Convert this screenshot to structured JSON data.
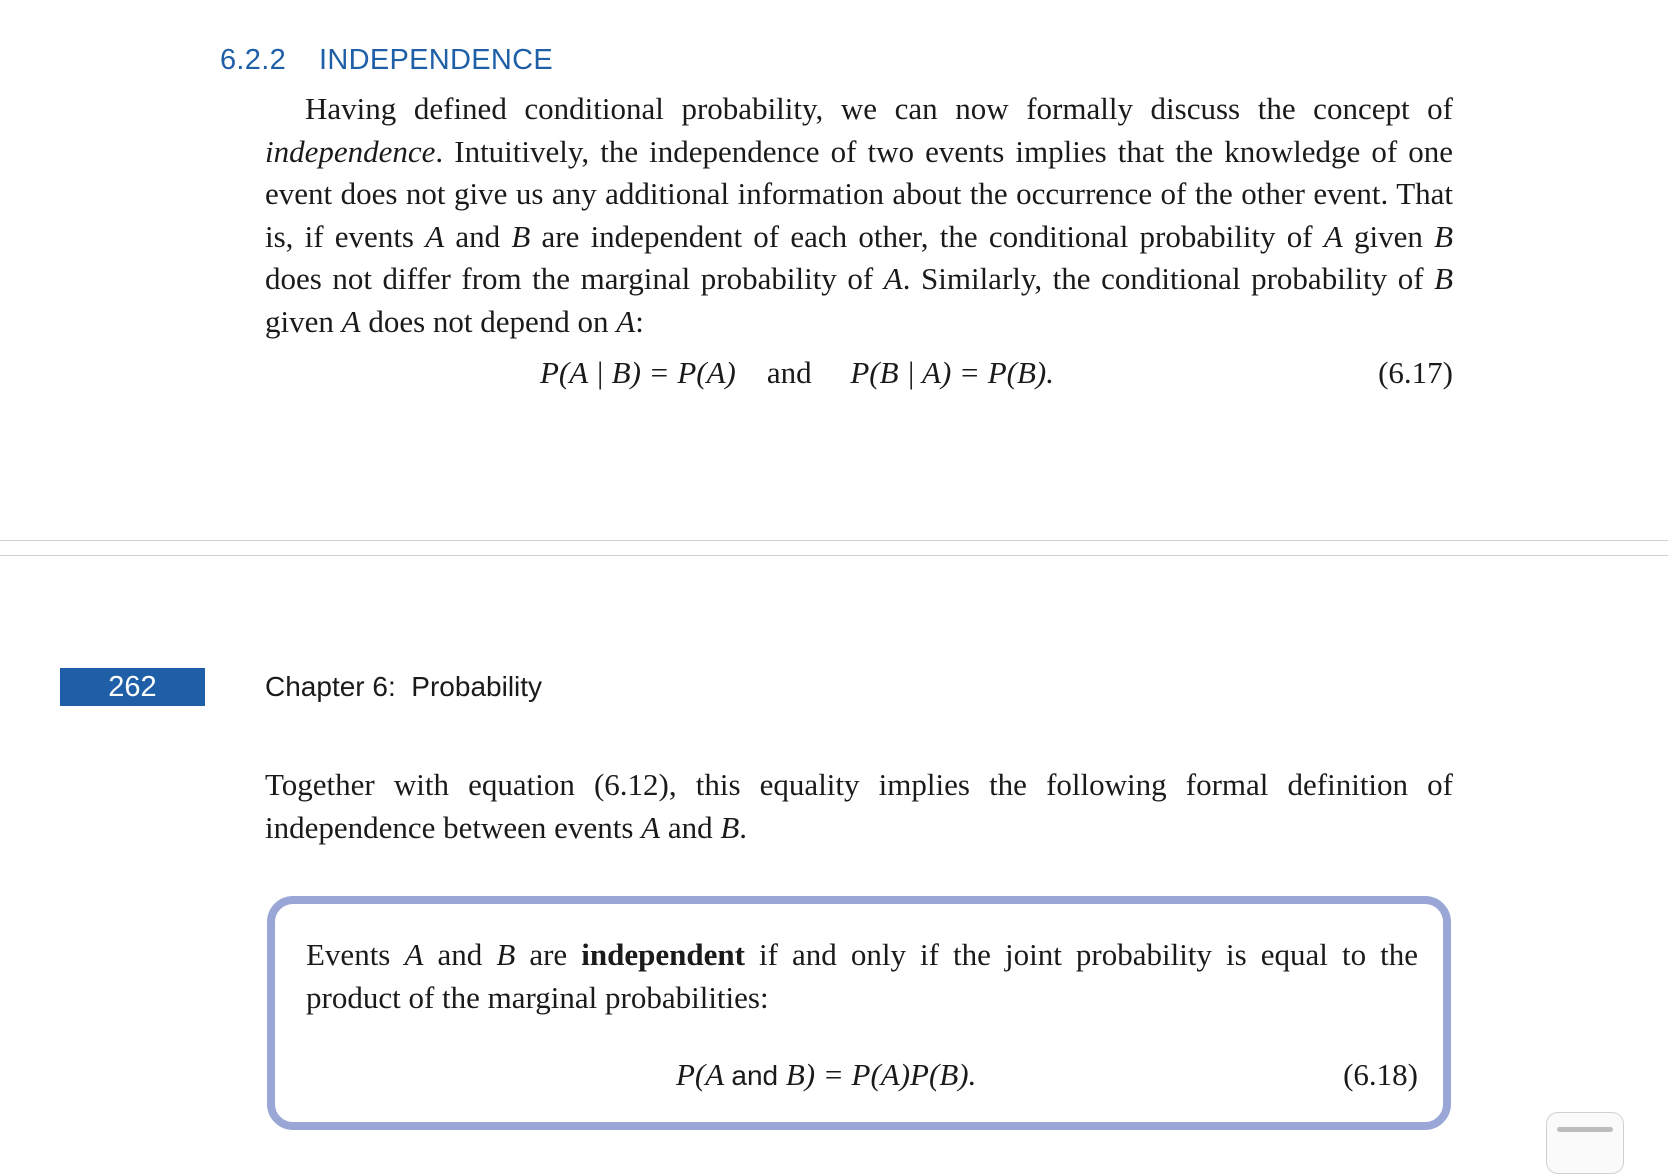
{
  "section": {
    "number": "6.2.2",
    "title": "INDEPENDENCE"
  },
  "paragraph1": {
    "s1": "Having defined conditional probability, we can now formally discuss the concept of ",
    "term": "independence",
    "s2": ". Intuitively, the independence of two events implies that the knowledge of one event does not give us any additional information about the occurrence of the other event. That is, if events ",
    "s3": " and ",
    "s4": " are independent of each other, the conditional probability of ",
    "s5": " given ",
    "s6": " does not differ from the marginal probability of ",
    "s7": ". Similarly, the conditional probability of ",
    "s8": " given ",
    "s9": " does not depend on ",
    "s10": ":"
  },
  "variables": {
    "a": "A",
    "b": "B"
  },
  "eq617": {
    "left": "P(A | B) = P(A)",
    "connector": "and",
    "right": "P(B | A) = P(B).",
    "number": "(6.17)"
  },
  "page_header": {
    "page_number": "262",
    "running_title": "Chapter 6:  Probability"
  },
  "paragraph2": {
    "s1": "Together with equation (6.12), this equality implies the following formal definition of independence between events ",
    "s2": " and ",
    "s3": "."
  },
  "definition": {
    "s1": "Events ",
    "s2": " and ",
    "s3": " are ",
    "term": "independent",
    "s4": " if and only if the joint probability is equal to the product of the marginal probabilities:"
  },
  "eq618": {
    "p1": "P(A ",
    "and": "and",
    "p2": " B) = P(A)P(B).",
    "number": "(6.18)"
  }
}
